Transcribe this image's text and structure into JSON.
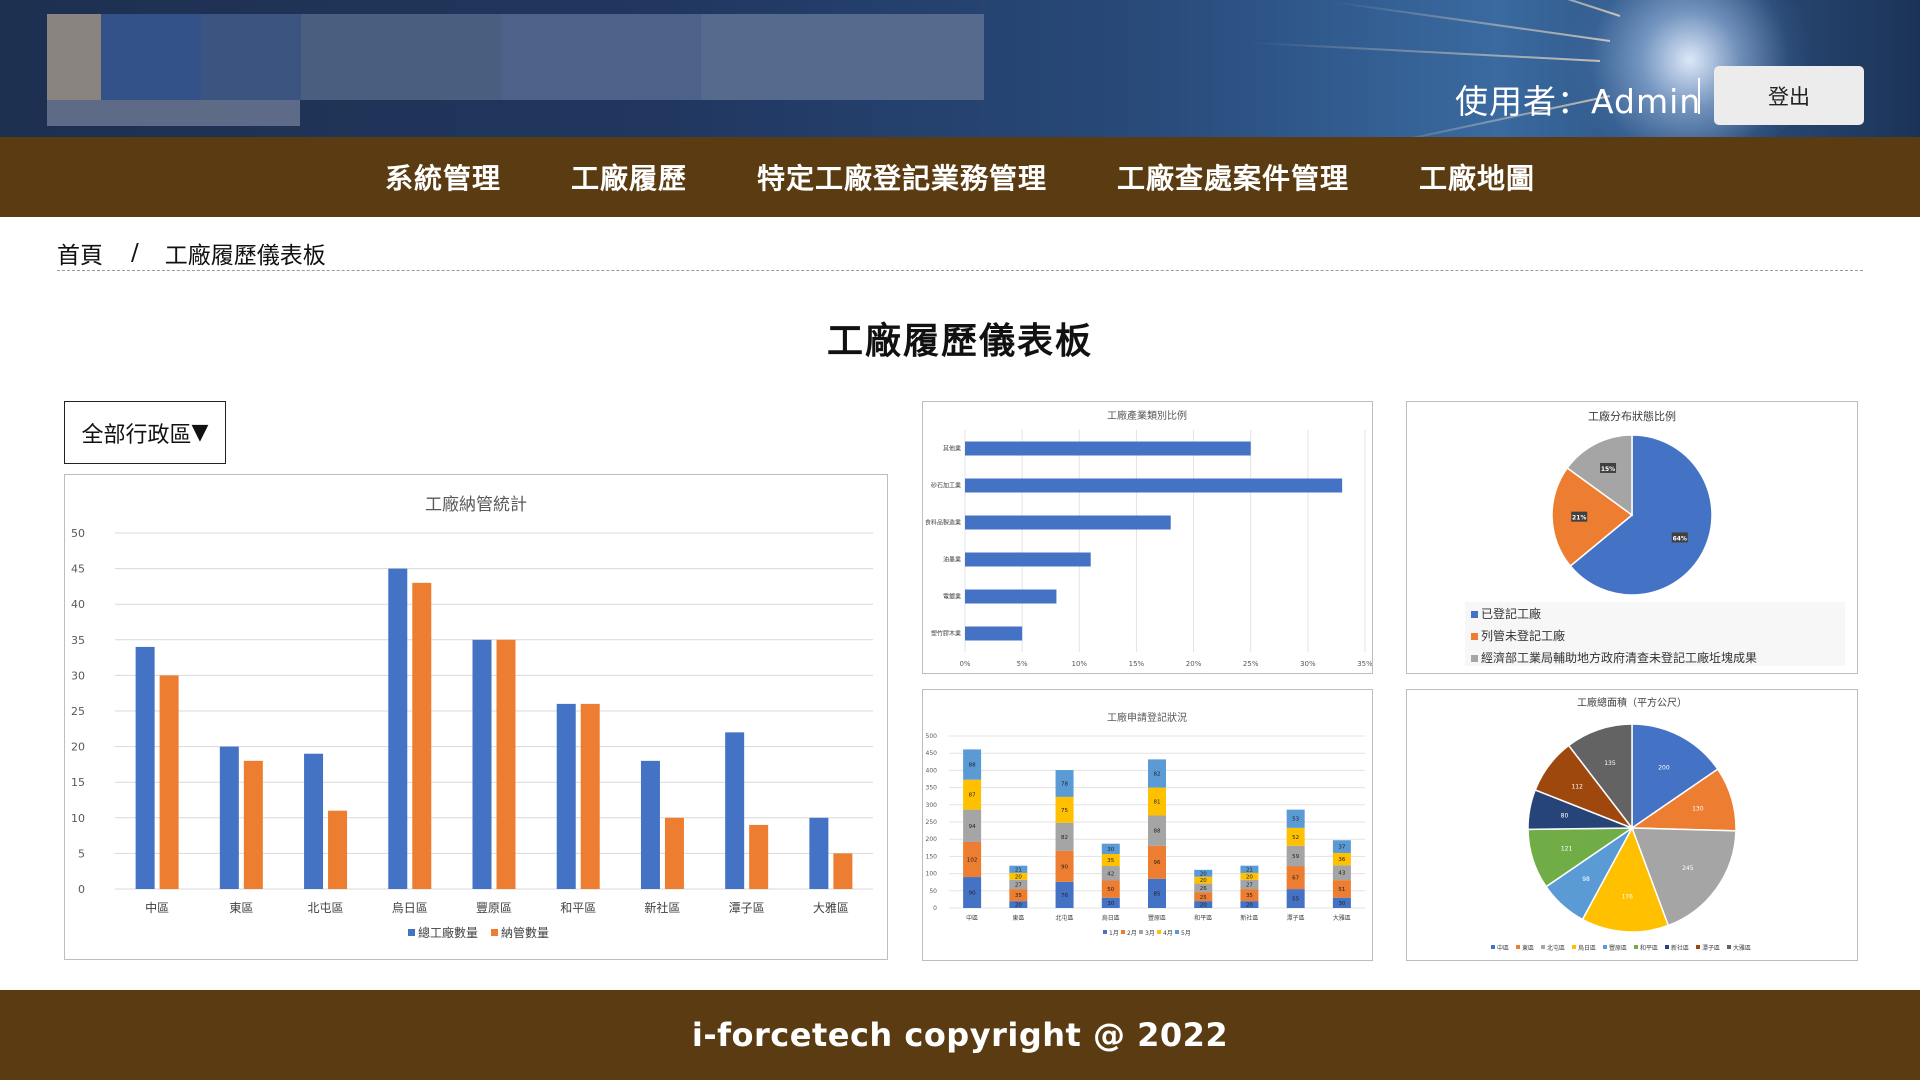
{
  "header": {
    "user_label": "使用者：Admin",
    "logout_label": "登出"
  },
  "nav": {
    "items": [
      "系統管理",
      "工廠履歷",
      "特定工廠登記業務管理",
      "工廠查處案件管理",
      "工廠地圖"
    ]
  },
  "breadcrumb": {
    "home": "首頁",
    "separator": "/",
    "current": "工廠履歷儀表板"
  },
  "page": {
    "title": "工廠履歷儀表板"
  },
  "filter": {
    "selected": "全部行政區",
    "arrow": "▼"
  },
  "footer": {
    "text": "i-forcetech copyright @ 2022"
  },
  "colors": {
    "blue": "#4472c4",
    "orange": "#ed7d31",
    "gray": "#a5a5a5",
    "yellow": "#ffc000",
    "lightblue": "#5b9bd5",
    "green": "#70ad47",
    "navy": "#264478",
    "brown": "#9e480e",
    "darkgray": "#636363",
    "nav_bg": "#5b3c12"
  },
  "chart_data": [
    {
      "id": "main",
      "type": "bar",
      "title": "工廠納管統計",
      "categories": [
        "中區",
        "東區",
        "北屯區",
        "烏日區",
        "豐原區",
        "和平區",
        "新社區",
        "潭子區",
        "大雅區"
      ],
      "series": [
        {
          "name": "總工廠數量",
          "color": "#4472c4",
          "values": [
            34,
            20,
            19,
            45,
            35,
            26,
            18,
            22,
            10
          ]
        },
        {
          "name": "納管數量",
          "color": "#ed7d31",
          "values": [
            30,
            18,
            11,
            43,
            35,
            26,
            10,
            9,
            5
          ]
        }
      ],
      "ylim": [
        0,
        50
      ],
      "yticks": [
        0,
        5,
        10,
        15,
        20,
        25,
        30,
        35,
        40,
        45,
        50
      ],
      "grid": true,
      "legend": "bottom"
    },
    {
      "id": "industry",
      "type": "bar",
      "orientation": "horizontal",
      "title": "工廠產業類別比例",
      "categories": [
        "其他業",
        "砂石加工業",
        "食料品製造業",
        "油墨業",
        "電鍍業",
        "塑竹膠木業"
      ],
      "values": [
        25,
        33,
        18,
        11,
        8,
        5
      ],
      "xlim": [
        0,
        35
      ],
      "xticks": [
        "0%",
        "5%",
        "10%",
        "15%",
        "20%",
        "25%",
        "30%",
        "35%"
      ],
      "grid": true
    },
    {
      "id": "status",
      "type": "pie",
      "title": "工廠分布狀態比例",
      "labels": [
        "已登記工廠",
        "列管未登記工廠",
        "經濟部工業局輔助地方政府清查未登記工廠坵塊成果"
      ],
      "values": [
        64,
        21,
        15
      ],
      "value_labels": [
        "64%",
        "21%",
        "15%"
      ],
      "colors": [
        "#4472c4",
        "#ed7d31",
        "#a5a5a5"
      ],
      "legend": "bottom"
    },
    {
      "id": "apply",
      "type": "bar",
      "stacked": true,
      "title": "工廠申請登記狀況",
      "categories": [
        "中區",
        "東區",
        "北屯區",
        "烏日區",
        "豐原區",
        "和平區",
        "新社區",
        "潭子區",
        "大雅區"
      ],
      "series": [
        {
          "name": "1月",
          "color": "#4472c4",
          "values": [
            90,
            20,
            76,
            30,
            85,
            20,
            20,
            55,
            30
          ]
        },
        {
          "name": "2月",
          "color": "#ed7d31",
          "values": [
            102,
            35,
            90,
            50,
            96,
            25,
            35,
            67,
            51
          ]
        },
        {
          "name": "3月",
          "color": "#a5a5a5",
          "values": [
            94,
            27,
            82,
            42,
            88,
            26,
            27,
            59,
            43
          ]
        },
        {
          "name": "4月",
          "color": "#ffc000",
          "values": [
            87,
            20,
            75,
            35,
            81,
            20,
            20,
            52,
            36
          ]
        },
        {
          "name": "5月",
          "color": "#5b9bd5",
          "values": [
            88,
            21,
            78,
            30,
            82,
            20,
            21,
            53,
            37
          ]
        }
      ],
      "ylim": [
        0,
        500
      ],
      "yticks": [
        0,
        50,
        100,
        150,
        200,
        250,
        300,
        350,
        400,
        450,
        500
      ],
      "grid": true,
      "legend": "bottom"
    },
    {
      "id": "area",
      "type": "pie",
      "title": "工廠總面積（平方公尺）",
      "labels": [
        "中區",
        "東區",
        "北屯區",
        "烏日區",
        "豐原區",
        "和平區",
        "新社區",
        "潭子區",
        "大雅區"
      ],
      "values": [
        200,
        130,
        245,
        176,
        98,
        121,
        80,
        112,
        135
      ],
      "colors": [
        "#4472c4",
        "#ed7d31",
        "#a5a5a5",
        "#ffc000",
        "#5b9bd5",
        "#70ad47",
        "#264478",
        "#9e480e",
        "#636363"
      ],
      "legend": "bottom"
    }
  ]
}
